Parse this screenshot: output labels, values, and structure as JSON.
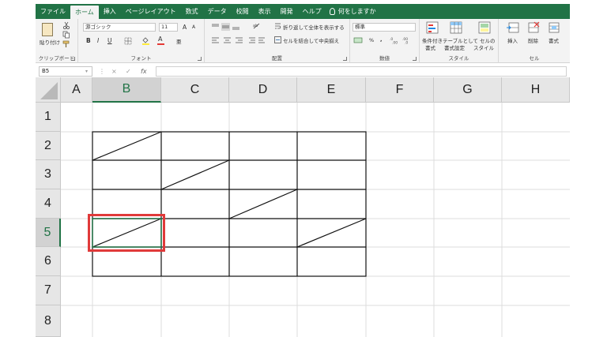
{
  "menu": {
    "tabs": [
      {
        "label": "ファイル",
        "active": false
      },
      {
        "label": "ホーム",
        "active": true
      },
      {
        "label": "挿入",
        "active": false
      },
      {
        "label": "ページレイアウト",
        "active": false
      },
      {
        "label": "数式",
        "active": false
      },
      {
        "label": "データ",
        "active": false
      },
      {
        "label": "校閲",
        "active": false
      },
      {
        "label": "表示",
        "active": false
      },
      {
        "label": "開発",
        "active": false
      },
      {
        "label": "ヘルプ",
        "active": false
      }
    ],
    "tell_me": "何をしますか"
  },
  "ribbon": {
    "clipboard": {
      "paste_label": "貼り付け",
      "group_label": "クリップボード"
    },
    "font": {
      "font_name": "游ゴシック",
      "font_size": "11",
      "bold": "B",
      "italic": "I",
      "underline": "U",
      "grow": "A",
      "shrink": "A",
      "color_a": "A",
      "phonetic": "亜",
      "group_label": "フォント"
    },
    "alignment": {
      "wrap_text": "折り返して全体を表示する",
      "merge_center": "セルを結合して中央揃え",
      "group_label": "配置"
    },
    "number": {
      "format": "標準",
      "percent": "%",
      "comma": ",",
      "group_label": "数値"
    },
    "styles": {
      "conditional": "条件付き",
      "conditional2": "書式",
      "table": "テーブルとして",
      "table2": "書式設定",
      "cell_styles": "セルの",
      "cell_styles2": "スタイル",
      "group_label": "スタイル"
    },
    "cells": {
      "insert": "挿入",
      "delete": "削除",
      "format": "書式",
      "group_label": "セル"
    }
  },
  "formula_bar": {
    "name_box": "B5",
    "cancel": "×",
    "enter": "✓",
    "fx": "fx",
    "formula": ""
  },
  "grid": {
    "columns": [
      "A",
      "B",
      "C",
      "D",
      "E",
      "F",
      "G",
      "H"
    ],
    "rows": [
      "1",
      "2",
      "3",
      "4",
      "5",
      "6",
      "7",
      "8"
    ],
    "selected_column": "B",
    "selected_row": "5",
    "selection_color": "#e03a3a",
    "header_accent": "#217346"
  }
}
